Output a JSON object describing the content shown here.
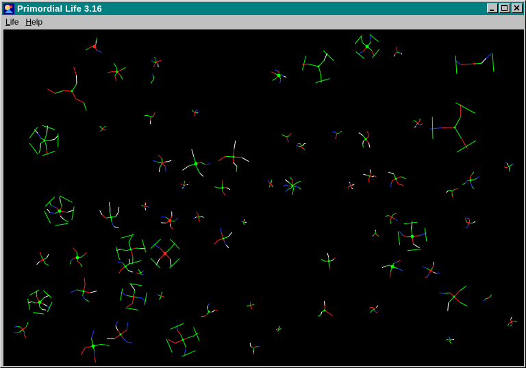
{
  "window": {
    "title": "Primordial Life 3.16",
    "app_icon": "primordial-life-app-icon",
    "controls": [
      "minimize-icon",
      "maximize-icon",
      "close-icon"
    ]
  },
  "menubar": {
    "items": [
      {
        "label": "Life",
        "accel": "L",
        "rest": "ife"
      },
      {
        "label": "Help",
        "accel": "H",
        "rest": "elp"
      }
    ]
  },
  "simulation": {
    "background": "#000000",
    "palette": {
      "green": "#00ff00",
      "red": "#ff2020",
      "blue": "#2040ff",
      "white": "#ffffff"
    }
  }
}
